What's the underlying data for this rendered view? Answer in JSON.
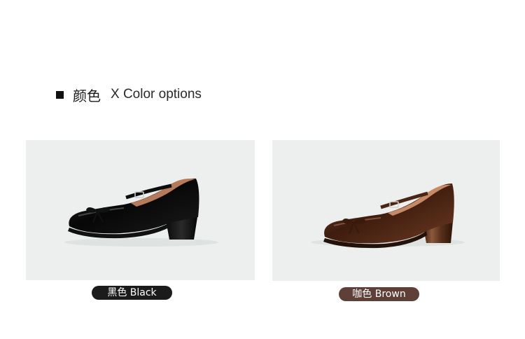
{
  "section": {
    "title_cn": "颜色",
    "title_en": "X Color options"
  },
  "options": [
    {
      "label": "黑色 Black",
      "badge_color": "#1b1b1b",
      "shoe_color": "#0d0d0d",
      "image_icon": "black-mary-jane-shoe"
    },
    {
      "label": "咖色 Brown",
      "badge_color": "#5e4039",
      "shoe_color": "#4a2415",
      "image_icon": "brown-mary-jane-shoe"
    }
  ],
  "colors": {
    "card_background": "#ecefee",
    "page_background": "#ffffff"
  }
}
